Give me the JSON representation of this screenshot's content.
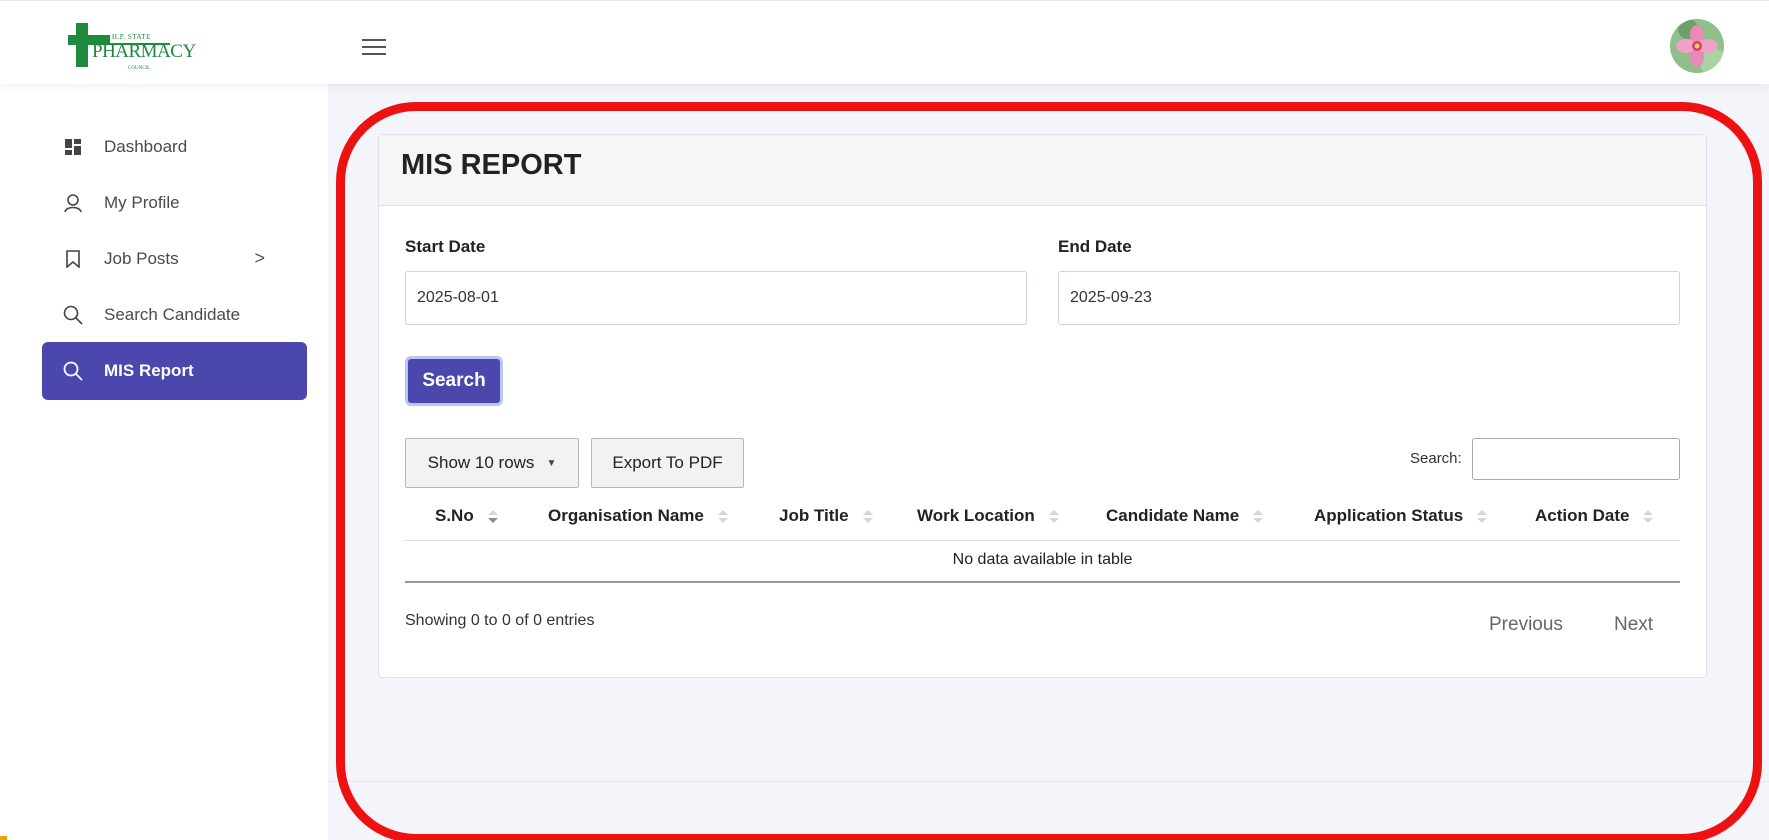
{
  "header": {
    "logo": {
      "line1": "H.P. STATE",
      "line2": "PHARMACY",
      "line3": "COUNCIL"
    }
  },
  "sidebar": {
    "items": [
      {
        "label": "Dashboard",
        "icon": "dashboard-icon"
      },
      {
        "label": "My Profile",
        "icon": "user-icon"
      },
      {
        "label": "Job Posts",
        "icon": "bookmark-icon",
        "chevron": ">"
      },
      {
        "label": "Search Candidate",
        "icon": "search-icon"
      },
      {
        "label": "MIS Report",
        "icon": "search-icon",
        "active": true
      }
    ]
  },
  "report": {
    "title": "MIS REPORT",
    "start_label": "Start Date",
    "start_value": "2025-08-01",
    "end_label": "End Date",
    "end_value": "2025-09-23",
    "search_button": "Search",
    "show_rows": "Show 10 rows",
    "show_rows_caret": "▼",
    "export_button": "Export To PDF",
    "table_search_label": "Search:",
    "table_search_value": "",
    "columns": [
      "S.No",
      "Organisation Name",
      "Job Title",
      "Work Location",
      "Candidate Name",
      "Application Status",
      "Action Date"
    ],
    "empty_message": "No data available in table",
    "info": "Showing 0 to 0 of 0 entries",
    "prev": "Previous",
    "next": "Next"
  },
  "colors": {
    "accent": "#4b47ad",
    "annotation": "#ee1111",
    "logo_green": "#1e8a3e",
    "background": "#f3f5fb"
  }
}
